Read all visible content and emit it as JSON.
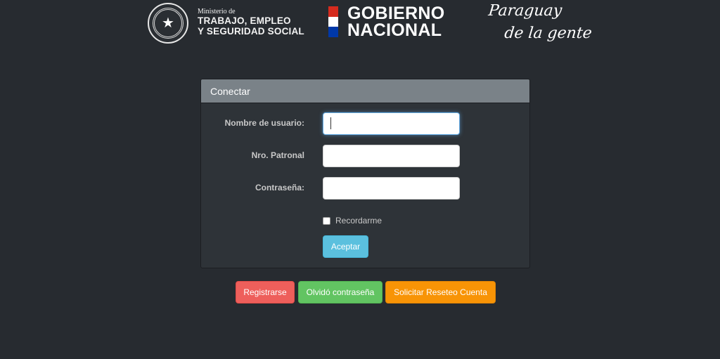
{
  "header": {
    "ministry": {
      "line1": "Ministerio de",
      "line2": "TRABAJO, EMPLEO",
      "line3": "Y SEGURIDAD SOCIAL"
    },
    "seal_icon": "national-seal-icon",
    "government": {
      "line1": "GOBIERNO",
      "line2": "NACIONAL",
      "flag_colors": [
        "#d52b1e",
        "#ffffff",
        "#0038a8"
      ]
    },
    "slogan": {
      "line1": "Paraguay",
      "line2": "de la gente"
    }
  },
  "login": {
    "title": "Conectar",
    "fields": [
      {
        "label": "Nombre de usuario:",
        "value": "",
        "placeholder": ""
      },
      {
        "label": "Nro. Patronal",
        "value": "",
        "placeholder": ""
      },
      {
        "label": "Contraseña:",
        "value": "",
        "placeholder": ""
      }
    ],
    "remember_label": "Recordarme",
    "submit_label": "Aceptar"
  },
  "actions": {
    "register_label": "Registrarse",
    "forgot_label": "Olvidó contraseña",
    "reset_label": "Solicitar Reseteo Cuenta"
  },
  "colors": {
    "background": "#272b30",
    "panel_heading": "#7a8288",
    "accept": "#5bc0de",
    "register": "#ee5f5b",
    "forgot": "#62c462",
    "reset": "#f89406"
  }
}
